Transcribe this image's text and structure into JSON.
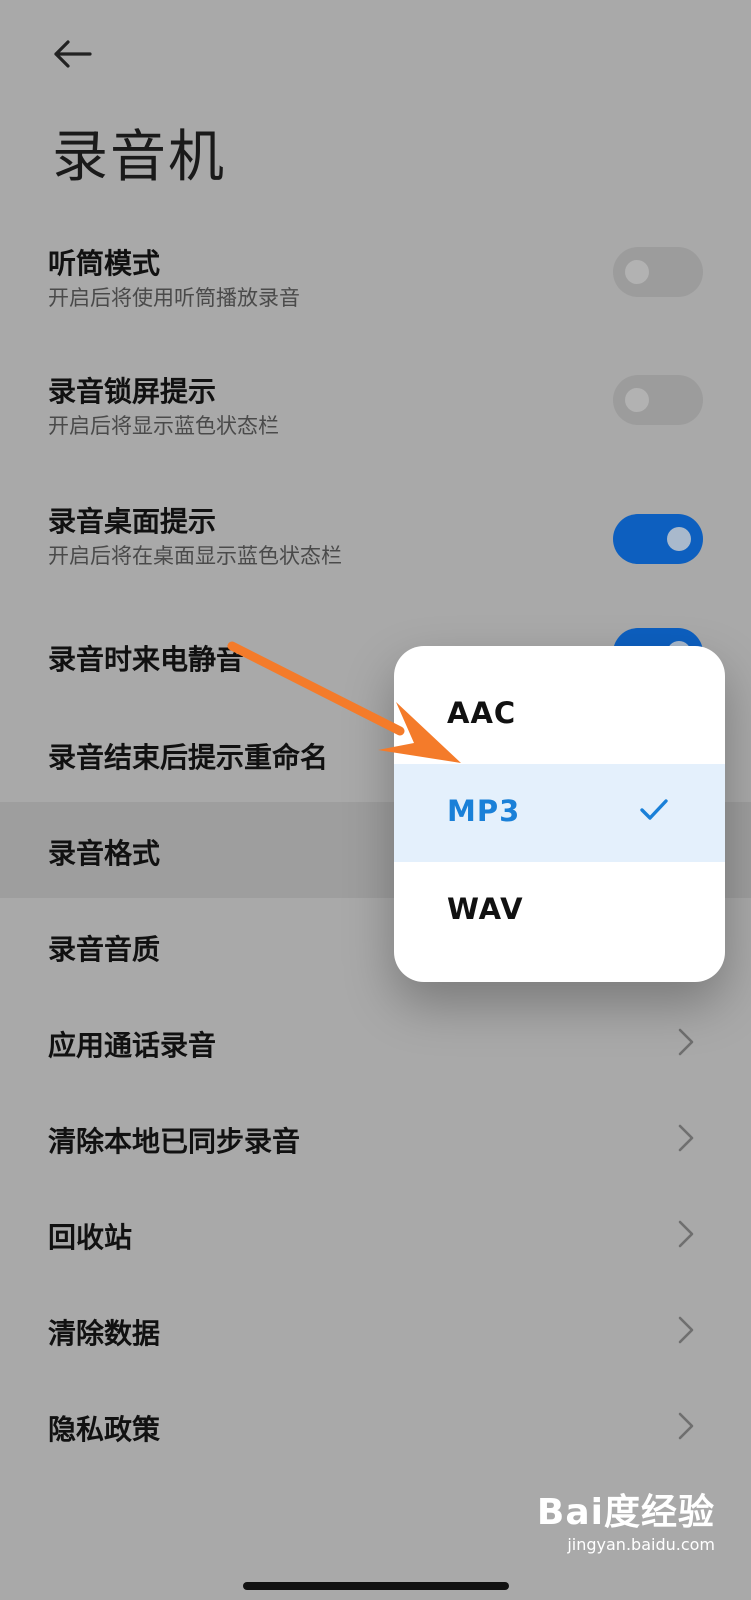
{
  "header": {
    "title": "录音机"
  },
  "settings": {
    "toggle_rows": [
      {
        "title": "听筒模式",
        "subtitle": "开启后将使用听筒播放录音",
        "on": false
      },
      {
        "title": "录音锁屏提示",
        "subtitle": "开启后将显示蓝色状态栏",
        "on": false
      },
      {
        "title": "录音桌面提示",
        "subtitle": "开启后将在桌面显示蓝色状态栏",
        "on": true
      },
      {
        "title": "录音时来电静音",
        "on": true
      }
    ],
    "rows": [
      {
        "title": "录音结束后提示重命名"
      },
      {
        "title": "录音格式"
      },
      {
        "title": "录音音质"
      },
      {
        "title": "应用通话录音"
      },
      {
        "title": "清除本地已同步录音"
      },
      {
        "title": "回收站"
      },
      {
        "title": "清除数据"
      },
      {
        "title": "隐私政策"
      }
    ]
  },
  "format_popup": {
    "options": [
      {
        "label": "AAC",
        "selected": false
      },
      {
        "label": "MP3",
        "selected": true
      },
      {
        "label": "WAV",
        "selected": false
      }
    ]
  },
  "watermark": {
    "brand": "Bai度经验",
    "url": "jingyan.baidu.com"
  },
  "colors": {
    "background": "#a9a9a9",
    "toggle_on": "#0d5fbf",
    "selected_text": "#1a80d8",
    "selected_bg": "#e4f0fc",
    "annotation_arrow": "#f47b2a"
  },
  "icons": {
    "back": "arrow-left-icon",
    "chevron": "chevron-right-icon",
    "check": "checkmark-icon"
  }
}
